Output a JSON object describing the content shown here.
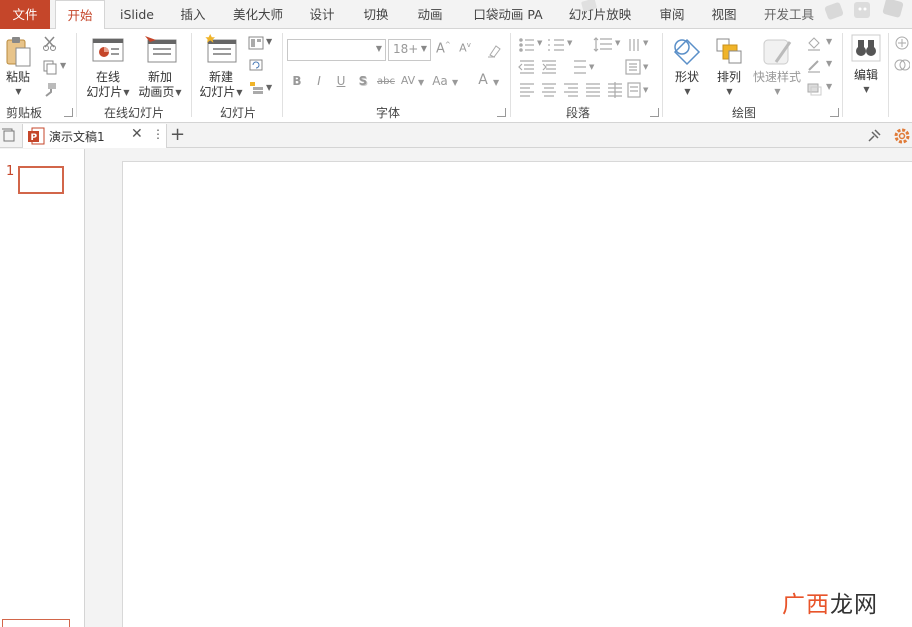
{
  "tabs": [
    {
      "label": "文件"
    },
    {
      "label": "开始"
    },
    {
      "label": "iSlide"
    },
    {
      "label": "插入"
    },
    {
      "label": "美化大师"
    },
    {
      "label": "设计"
    },
    {
      "label": "切换"
    },
    {
      "label": "动画"
    },
    {
      "label": "口袋动画 PA"
    },
    {
      "label": "幻灯片放映"
    },
    {
      "label": "审阅"
    },
    {
      "label": "视图"
    },
    {
      "label": "开发工具"
    }
  ],
  "clipboard": {
    "paste": "粘贴",
    "group": "剪贴板"
  },
  "online": {
    "online_slide_1": "在线",
    "online_slide_2": "幻灯片",
    "new_anim_1": "新加",
    "new_anim_2": "动画页",
    "group": "在线幻灯片"
  },
  "slides": {
    "new_slide_1": "新建",
    "new_slide_2": "幻灯片",
    "group": "幻灯片"
  },
  "font": {
    "font_name": "",
    "font_size": "18+",
    "bold": "B",
    "italic": "I",
    "underline": "U",
    "shadow": "S",
    "strike": "abc",
    "spacing": "AV",
    "case": "Aa",
    "color": "A",
    "grow": "A",
    "shrink": "A",
    "group": "字体"
  },
  "paragraph": {
    "group": "段落"
  },
  "drawing": {
    "shape": "形状",
    "arrange": "排列",
    "quick_style": "快速样式",
    "group": "绘图"
  },
  "editing": {
    "edit": "编辑"
  },
  "doc": {
    "tab_title": "演示文稿1"
  },
  "thumbs": [
    {
      "number": "1"
    }
  ],
  "watermark": {
    "part1": "广西",
    "part2": "龙网"
  },
  "colors": {
    "accent": "#c5462a",
    "thumb_border": "#d2664a"
  }
}
